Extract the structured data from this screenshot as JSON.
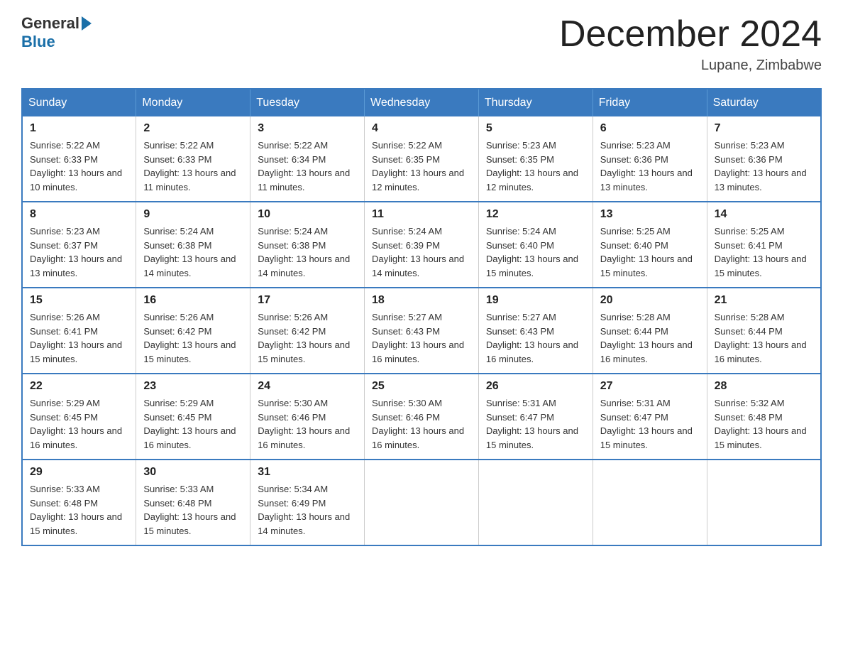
{
  "header": {
    "logo_general": "General",
    "logo_blue": "Blue",
    "month_title": "December 2024",
    "location": "Lupane, Zimbabwe"
  },
  "weekdays": [
    "Sunday",
    "Monday",
    "Tuesday",
    "Wednesday",
    "Thursday",
    "Friday",
    "Saturday"
  ],
  "weeks": [
    [
      {
        "day": "1",
        "sunrise": "5:22 AM",
        "sunset": "6:33 PM",
        "daylight": "13 hours and 10 minutes."
      },
      {
        "day": "2",
        "sunrise": "5:22 AM",
        "sunset": "6:33 PM",
        "daylight": "13 hours and 11 minutes."
      },
      {
        "day": "3",
        "sunrise": "5:22 AM",
        "sunset": "6:34 PM",
        "daylight": "13 hours and 11 minutes."
      },
      {
        "day": "4",
        "sunrise": "5:22 AM",
        "sunset": "6:35 PM",
        "daylight": "13 hours and 12 minutes."
      },
      {
        "day": "5",
        "sunrise": "5:23 AM",
        "sunset": "6:35 PM",
        "daylight": "13 hours and 12 minutes."
      },
      {
        "day": "6",
        "sunrise": "5:23 AM",
        "sunset": "6:36 PM",
        "daylight": "13 hours and 13 minutes."
      },
      {
        "day": "7",
        "sunrise": "5:23 AM",
        "sunset": "6:36 PM",
        "daylight": "13 hours and 13 minutes."
      }
    ],
    [
      {
        "day": "8",
        "sunrise": "5:23 AM",
        "sunset": "6:37 PM",
        "daylight": "13 hours and 13 minutes."
      },
      {
        "day": "9",
        "sunrise": "5:24 AM",
        "sunset": "6:38 PM",
        "daylight": "13 hours and 14 minutes."
      },
      {
        "day": "10",
        "sunrise": "5:24 AM",
        "sunset": "6:38 PM",
        "daylight": "13 hours and 14 minutes."
      },
      {
        "day": "11",
        "sunrise": "5:24 AM",
        "sunset": "6:39 PM",
        "daylight": "13 hours and 14 minutes."
      },
      {
        "day": "12",
        "sunrise": "5:24 AM",
        "sunset": "6:40 PM",
        "daylight": "13 hours and 15 minutes."
      },
      {
        "day": "13",
        "sunrise": "5:25 AM",
        "sunset": "6:40 PM",
        "daylight": "13 hours and 15 minutes."
      },
      {
        "day": "14",
        "sunrise": "5:25 AM",
        "sunset": "6:41 PM",
        "daylight": "13 hours and 15 minutes."
      }
    ],
    [
      {
        "day": "15",
        "sunrise": "5:26 AM",
        "sunset": "6:41 PM",
        "daylight": "13 hours and 15 minutes."
      },
      {
        "day": "16",
        "sunrise": "5:26 AM",
        "sunset": "6:42 PM",
        "daylight": "13 hours and 15 minutes."
      },
      {
        "day": "17",
        "sunrise": "5:26 AM",
        "sunset": "6:42 PM",
        "daylight": "13 hours and 15 minutes."
      },
      {
        "day": "18",
        "sunrise": "5:27 AM",
        "sunset": "6:43 PM",
        "daylight": "13 hours and 16 minutes."
      },
      {
        "day": "19",
        "sunrise": "5:27 AM",
        "sunset": "6:43 PM",
        "daylight": "13 hours and 16 minutes."
      },
      {
        "day": "20",
        "sunrise": "5:28 AM",
        "sunset": "6:44 PM",
        "daylight": "13 hours and 16 minutes."
      },
      {
        "day": "21",
        "sunrise": "5:28 AM",
        "sunset": "6:44 PM",
        "daylight": "13 hours and 16 minutes."
      }
    ],
    [
      {
        "day": "22",
        "sunrise": "5:29 AM",
        "sunset": "6:45 PM",
        "daylight": "13 hours and 16 minutes."
      },
      {
        "day": "23",
        "sunrise": "5:29 AM",
        "sunset": "6:45 PM",
        "daylight": "13 hours and 16 minutes."
      },
      {
        "day": "24",
        "sunrise": "5:30 AM",
        "sunset": "6:46 PM",
        "daylight": "13 hours and 16 minutes."
      },
      {
        "day": "25",
        "sunrise": "5:30 AM",
        "sunset": "6:46 PM",
        "daylight": "13 hours and 16 minutes."
      },
      {
        "day": "26",
        "sunrise": "5:31 AM",
        "sunset": "6:47 PM",
        "daylight": "13 hours and 15 minutes."
      },
      {
        "day": "27",
        "sunrise": "5:31 AM",
        "sunset": "6:47 PM",
        "daylight": "13 hours and 15 minutes."
      },
      {
        "day": "28",
        "sunrise": "5:32 AM",
        "sunset": "6:48 PM",
        "daylight": "13 hours and 15 minutes."
      }
    ],
    [
      {
        "day": "29",
        "sunrise": "5:33 AM",
        "sunset": "6:48 PM",
        "daylight": "13 hours and 15 minutes."
      },
      {
        "day": "30",
        "sunrise": "5:33 AM",
        "sunset": "6:48 PM",
        "daylight": "13 hours and 15 minutes."
      },
      {
        "day": "31",
        "sunrise": "5:34 AM",
        "sunset": "6:49 PM",
        "daylight": "13 hours and 14 minutes."
      },
      null,
      null,
      null,
      null
    ]
  ]
}
